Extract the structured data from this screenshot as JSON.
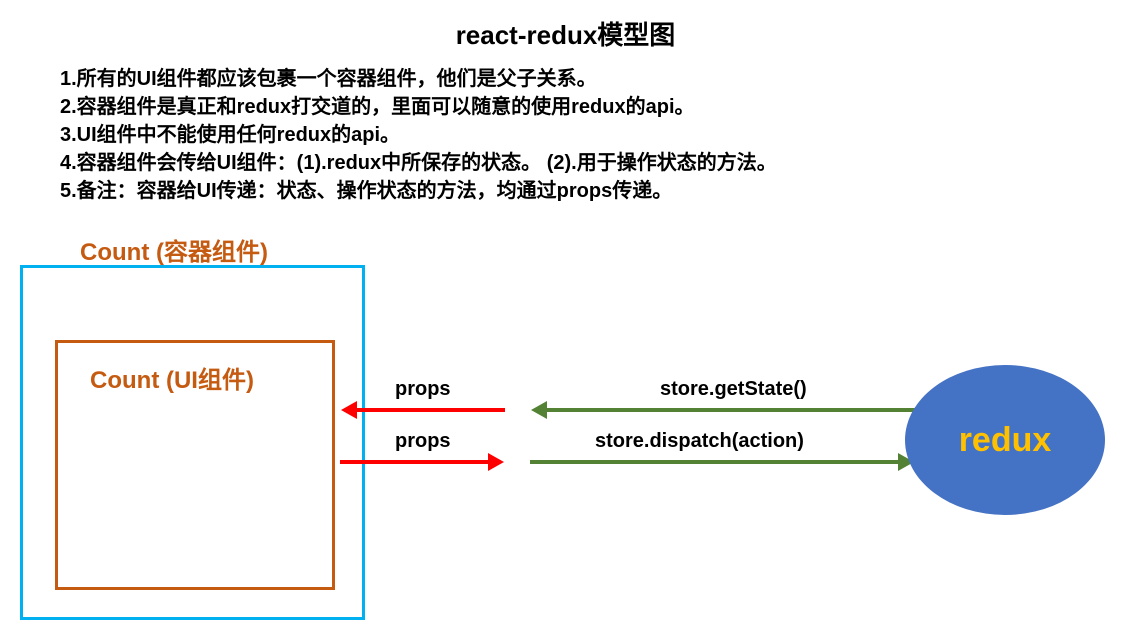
{
  "title": "react-redux模型图",
  "notes": {
    "line1": "1.所有的UI组件都应该包裹一个容器组件，他们是父子关系。",
    "line2": "2.容器组件是真正和redux打交道的，里面可以随意的使用redux的api。",
    "line3": "3.UI组件中不能使用任何redux的api。",
    "line4": "4.容器组件会传给UI组件：(1).redux中所保存的状态。  (2).用于操作状态的方法。",
    "line5": "5.备注：容器给UI传递：状态、操作状态的方法，均通过props传递。"
  },
  "containerLabel": "Count (容器组件)",
  "uiLabel": "Count (UI组件)",
  "arrows": {
    "propsIn": "props",
    "propsOut": "props",
    "getState": "store.getState()",
    "dispatch": "store.dispatch(action)"
  },
  "reduxLabel": "redux"
}
